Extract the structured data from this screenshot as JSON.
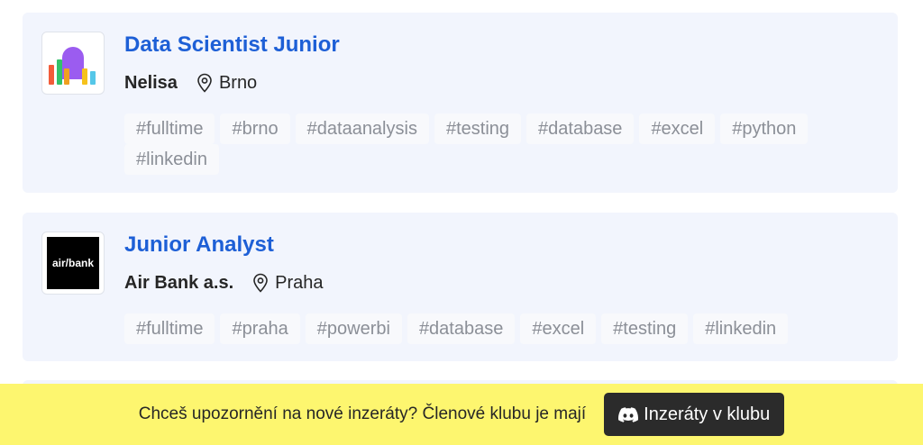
{
  "jobs": [
    {
      "title": "Data Scientist Junior",
      "company": "Nelisa",
      "location": "Brno",
      "tags": [
        "#fulltime",
        "#brno",
        "#dataanalysis",
        "#testing",
        "#database",
        "#excel",
        "#python",
        "#linkedin"
      ]
    },
    {
      "title": "Junior Analyst",
      "company": "Air Bank a.s.",
      "location": "Praha",
      "logo_text": "air/bank",
      "tags": [
        "#fulltime",
        "#praha",
        "#powerbi",
        "#database",
        "#excel",
        "#testing",
        "#linkedin"
      ]
    }
  ],
  "banner": {
    "text": "Chceš upozornění na nové inzeráty? Členové klubu je mají",
    "button_label": "Inzeráty v klubu",
    "button_icon": "discord-icon"
  },
  "colors": {
    "card_bg": "#f2f5fd",
    "title_link": "#1d5fd6",
    "tag_text": "#8b8f97",
    "banner_bg": "#fdf66f",
    "button_bg": "#2b2b2b"
  }
}
